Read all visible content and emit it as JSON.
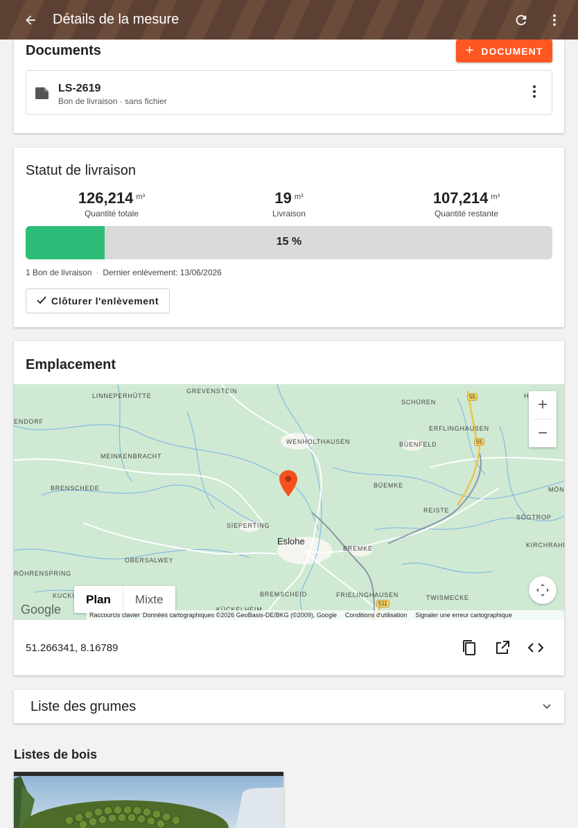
{
  "appbar": {
    "title": "Détails de la mesure",
    "back_icon": "arrow-left-icon",
    "refresh_icon": "refresh-icon",
    "more_icon": "more-vertical-icon"
  },
  "documents": {
    "title": "Documents",
    "add_label": "DOCUMENT",
    "items": [
      {
        "name": "LS-2619",
        "subtitle": "Bon de livraison · sans fichier"
      }
    ]
  },
  "status": {
    "title": "Statut de livraison",
    "stats": [
      {
        "value": "126,214",
        "unit": "m³",
        "label": "Quantité totale"
      },
      {
        "value": "19",
        "unit": "m³",
        "label": "Livraison"
      },
      {
        "value": "107,214",
        "unit": "m³",
        "label": "Quantité restante"
      }
    ],
    "progress_percent": 15,
    "progress_label": "15 %",
    "notes_count": "1 Bon de livraison",
    "last_pickup": "Dernier enlèvement: 13/06/2026",
    "close_label": "Clôturer l'enlèvement",
    "progress_color": "#2dbd78"
  },
  "location": {
    "title": "Emplacement",
    "map": {
      "places": [
        "LINNEPERHÜTTE",
        "GREVENSTEIN",
        "SCHÜREN",
        "HORBA",
        "ENDORF",
        "ERFLINGHAUSEN",
        "WENHOLTHAUSEN",
        "BÜENFELD",
        "MEINKENBRACHT",
        "BRENSCHEDE",
        "BÜEMKE",
        "MÖN",
        "REISTE",
        "SÖGTROP",
        "SIEPERTING",
        "Eslohe",
        "BREMKE",
        "KIRCHRAHE",
        "OBERSALWEY",
        "RÖHRENSPRING",
        "KUCKU",
        "BREMSCHEID",
        "FRIELINGHAUSEN",
        "TWISMECKE",
        "KÜCKELHEIM"
      ],
      "roads": [
        "55",
        "55",
        "511"
      ],
      "type_plan": "Plan",
      "type_mixed": "Mixte",
      "google": "Google",
      "attrib_shortcuts": "Raccourcis clavier",
      "attrib_data": "Données cartographiques ©2026 GeoBasis-DE/BKG (©2009), Google",
      "attrib_terms": "Conditions d'utilisation",
      "attrib_report": "Signaler une erreur cartographique"
    },
    "coords": "51.266341, 8.16789"
  },
  "logs": {
    "title": "Liste des grumes"
  },
  "wood_lists": {
    "title": "Listes de bois"
  },
  "colors": {
    "accent": "#ff5722",
    "appbar": "#5c4033",
    "pin": "#f4511e"
  }
}
